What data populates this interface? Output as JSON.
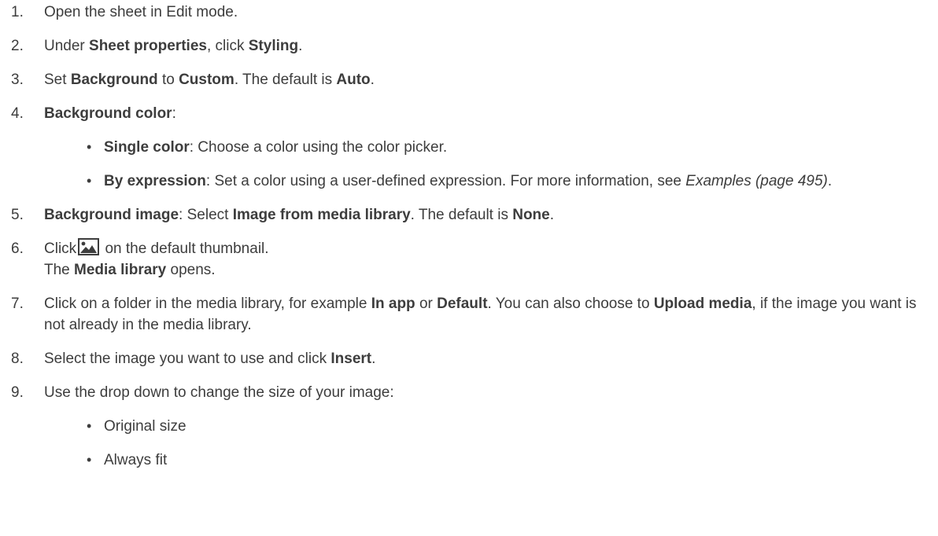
{
  "steps": [
    {
      "num": "1.",
      "parts": [
        "Open the sheet in Edit mode."
      ]
    },
    {
      "num": "2.",
      "t1": "Under ",
      "b1": "Sheet properties",
      "t2": ", click ",
      "b2": "Styling",
      "t3": "."
    },
    {
      "num": "3.",
      "t1": "Set ",
      "b1": "Background",
      "t2": " to ",
      "b2": "Custom",
      "t3": ". The default is ",
      "b3": "Auto",
      "t4": "."
    },
    {
      "num": "4.",
      "b1": "Background color",
      "t1": ":",
      "bullets": [
        {
          "b": "Single color",
          "t": ": Choose a color using the color picker."
        },
        {
          "b": "By expression",
          "t": ": Set a color using a user-defined expression. For more information, see ",
          "i": "Examples (page 495)",
          "t2": "."
        }
      ]
    },
    {
      "num": "5.",
      "b1": "Background image",
      "t1": ": Select ",
      "b2": "Image from media library",
      "t2": ". The default is ",
      "b3": "None",
      "t3": "."
    },
    {
      "num": "6.",
      "t1": "Click",
      "t2": " on the default thumbnail.",
      "l2a": "The ",
      "l2b": "Media library",
      "l2c": " opens."
    },
    {
      "num": "7.",
      "t1": "Click on a folder in the media library, for example ",
      "b1": "In app",
      "t2": " or ",
      "b2": "Default",
      "t3": ". You can also choose to ",
      "b3": "Upload media",
      "t4": ", if the image you want is not already in the media library."
    },
    {
      "num": "8.",
      "t1": "Select the image you want to use and click ",
      "b1": "Insert",
      "t2": "."
    },
    {
      "num": "9.",
      "t1": "Use the drop down to change the size of your image:",
      "bullets": [
        {
          "t": "Original size"
        },
        {
          "t": "Always fit"
        }
      ]
    }
  ],
  "icons": {
    "image_icon": "image-icon",
    "bullet_glyph": "•"
  }
}
